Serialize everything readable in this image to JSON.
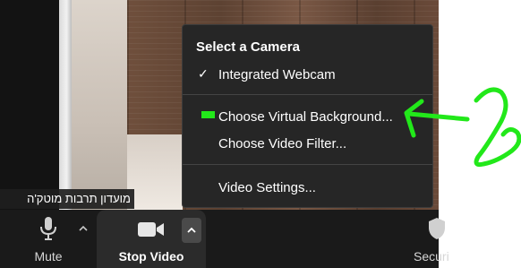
{
  "video": {
    "participant_name": "מועדון תרבות מוטק'ה"
  },
  "menu": {
    "title": "Select a Camera",
    "items": [
      {
        "label": "Integrated Webcam",
        "checked": true
      },
      {
        "label": "Choose Virtual Background..."
      },
      {
        "label": "Choose Video Filter..."
      },
      {
        "label": "Video Settings..."
      }
    ]
  },
  "toolbar": {
    "mute_label": "Mute",
    "stop_video_label": "Stop Video",
    "security_label": "Security"
  },
  "annotation": {
    "text": "2",
    "color": "#22e81a"
  }
}
